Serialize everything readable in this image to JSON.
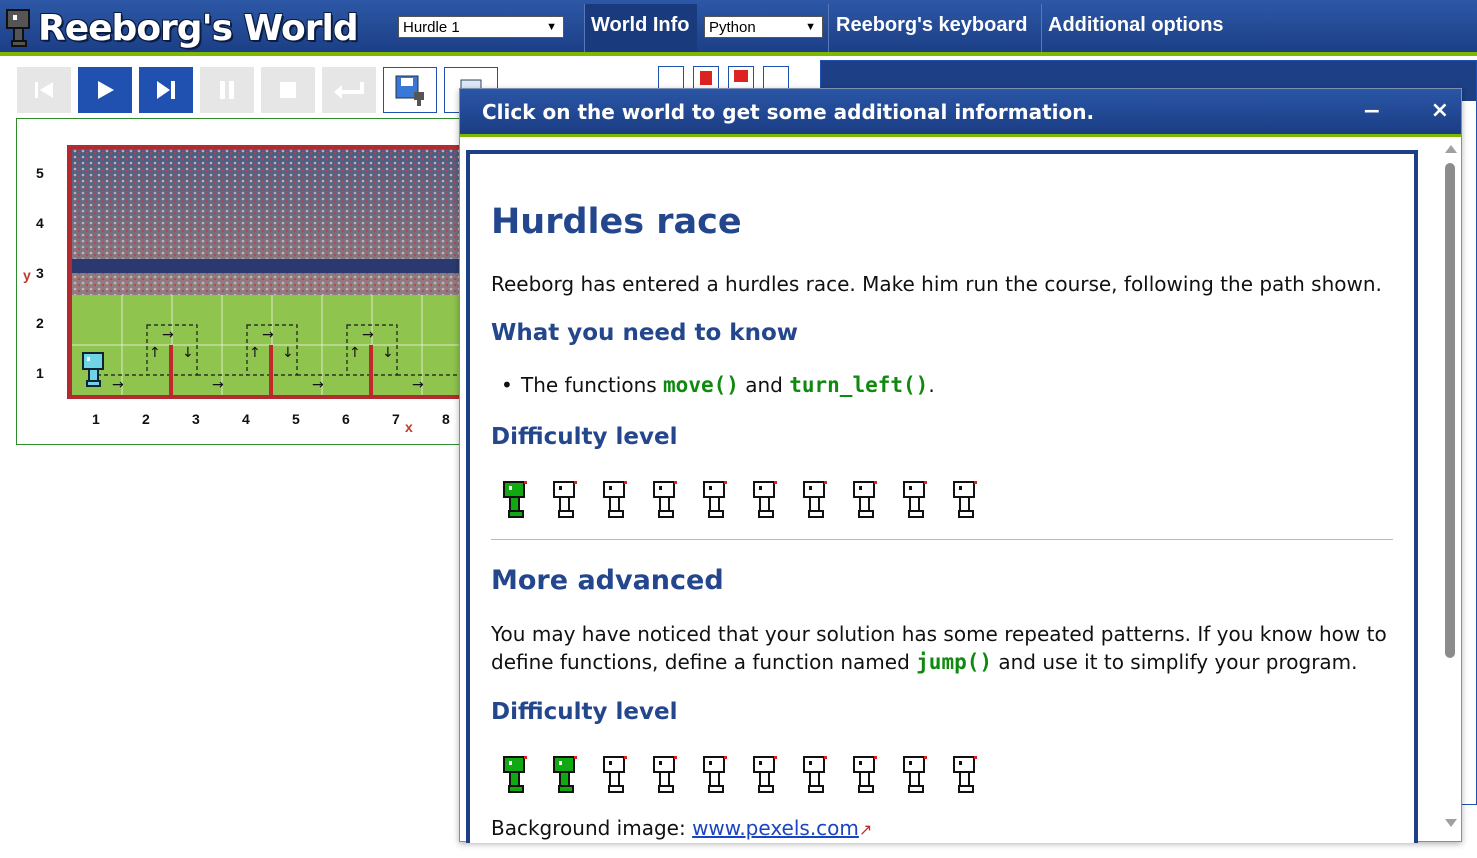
{
  "header": {
    "title": "Reeborg's World",
    "world_select": "Hurdle 1",
    "world_info_tab": "World Info",
    "language_select": "Python",
    "keyboard_tab": "Reeborg's keyboard",
    "options_tab": "Additional options"
  },
  "toolbar": {
    "buttons": [
      "reload-icon",
      "run-icon",
      "step-icon",
      "pause-icon",
      "stop-icon",
      "return-icon",
      "save-icon",
      "clipboard-icon"
    ]
  },
  "world": {
    "y_ticks": [
      "5",
      "4",
      "3",
      "2",
      "1"
    ],
    "x_ticks": [
      "1",
      "2",
      "3",
      "4",
      "5",
      "6",
      "7",
      "8"
    ],
    "y_axis_letter": "y",
    "x_axis_letter": "x"
  },
  "dialog": {
    "title": "Click on the world to get some additional information.",
    "minimize_label": "−",
    "close_label": "×"
  },
  "content": {
    "heading": "Hurdles race",
    "intro": "Reeborg has entered a hurdles race. Make him run the course, following the path shown.",
    "need_to_know": "What you need to know",
    "bullet_prefix": "The functions ",
    "fn_move": "move()",
    "bullet_and": " and ",
    "fn_turn_left": "turn_left()",
    "bullet_suffix": ".",
    "difficulty_1": "Difficulty level",
    "difficulty_1_level": 1,
    "difficulty_max": 10,
    "more_advanced": "More advanced",
    "advanced_text_1": "You may have noticed that your solution has some repeated patterns. If you know how to",
    "advanced_text_2a": "define functions, define a function named ",
    "fn_jump": "jump()",
    "advanced_text_2b": " and use it to simplify your program.",
    "difficulty_2": "Difficulty level",
    "difficulty_2_level": 2,
    "background_prefix": "Background image: ",
    "background_link": "www.pexels.com"
  },
  "colors": {
    "brand_blue": "#1c3f86",
    "accent_green": "#7fb800",
    "code_green": "#0f8a0f",
    "wall_red": "#c0282d"
  }
}
